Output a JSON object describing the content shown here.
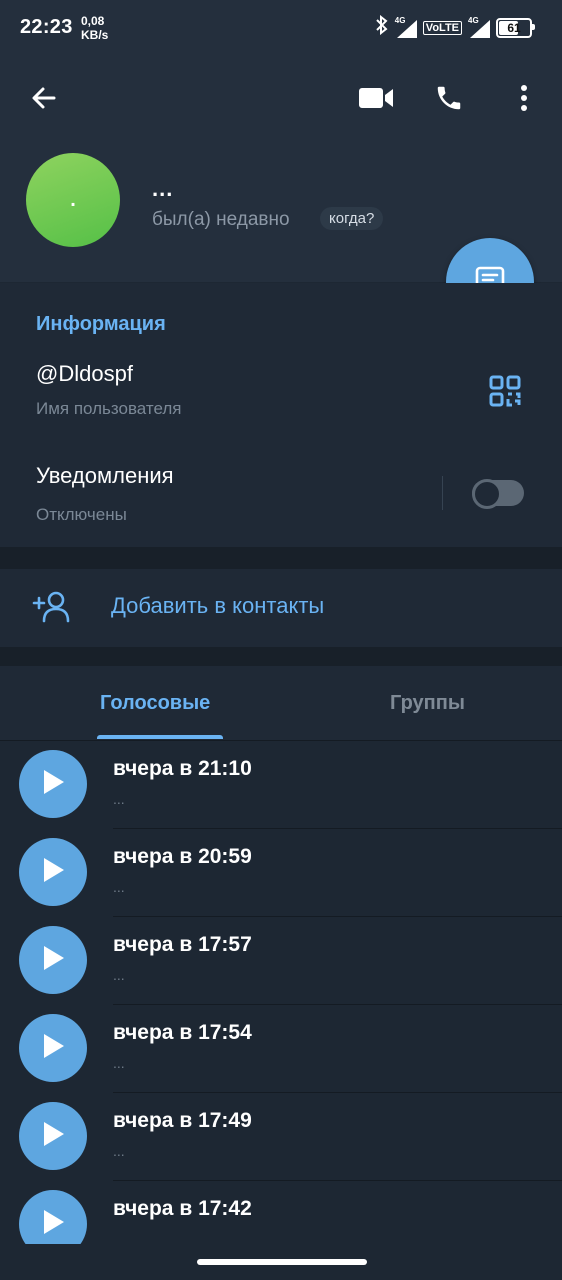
{
  "status_bar": {
    "time": "22:23",
    "net_speed_value": "0,08",
    "net_speed_unit": "KB/s",
    "signal1_label": "4G",
    "volte_label": "VoLTE",
    "signal2_label": "4G",
    "battery": "61"
  },
  "header": {
    "name": "...",
    "avatar_letter": ".",
    "last_seen": "был(а) недавно",
    "when_chip": "когда?",
    "icons": [
      "back-arrow-icon",
      "video-call-icon",
      "phone-icon",
      "more-vertical-icon"
    ]
  },
  "info": {
    "section_title": "Информация",
    "username": "@Dldospf",
    "username_caption": "Имя пользователя",
    "notifications_label": "Уведомления",
    "notifications_status": "Отключены",
    "notifications_enabled": false
  },
  "add_contact": {
    "label": "Добавить в контакты"
  },
  "tabs": [
    {
      "label": "Голосовые",
      "active": true
    },
    {
      "label": "Группы",
      "active": false
    }
  ],
  "voice_messages": [
    {
      "title": "вчера в 21:10",
      "subtitle": "..."
    },
    {
      "title": "вчера в 20:59",
      "subtitle": "..."
    },
    {
      "title": "вчера в 17:57",
      "subtitle": "..."
    },
    {
      "title": "вчера в 17:54",
      "subtitle": "..."
    },
    {
      "title": "вчера в 17:49",
      "subtitle": "..."
    },
    {
      "title": "вчера в 17:42",
      "subtitle": ""
    }
  ],
  "colors": {
    "accent": "#6ab3f3",
    "button_blue": "#5ea6e0",
    "avatar_green": "#6cc94f",
    "background": "#1d2733"
  }
}
